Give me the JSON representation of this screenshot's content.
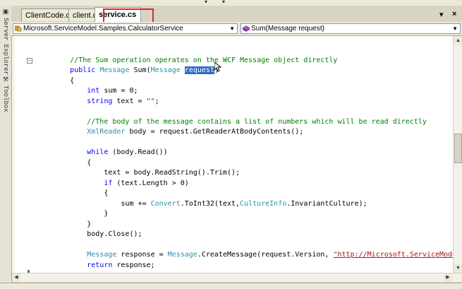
{
  "left_panels": [
    {
      "label": "Server Explorer",
      "icon": "server-explorer-icon"
    },
    {
      "label": "Toolbox",
      "icon": "toolbox-icon"
    }
  ],
  "tabs": [
    {
      "label": "ClientCode.cs",
      "active": false
    },
    {
      "label": "client.cs",
      "active": false
    },
    {
      "label": "service.cs",
      "active": true
    }
  ],
  "tab_controls": {
    "dropdown": "▾",
    "close": "×"
  },
  "navbar": {
    "type_combo": "Microsoft.ServiceModel.Samples.CalculatorService",
    "member_combo": "Sum(Message request)"
  },
  "code_lines": [
    "",
    "        //The Sum operation operates on the WCF Message object directly",
    "        public Message Sum(Message request)",
    "        {",
    "            int sum = 0;",
    "            string text = \"\";",
    "",
    "            //The body of the message contains a list of numbers which will be read directly",
    "            XmlReader body = request.GetReaderAtBodyContents();",
    "",
    "            while (body.Read())",
    "            {",
    "                text = body.ReadString().Trim();",
    "                if (text.Length > 0)",
    "                {",
    "                    sum += Convert.ToInt32(text,CultureInfo.InvariantCulture);",
    "                }",
    "            }",
    "            body.Close();",
    "",
    "            Message response = Message.CreateMessage(request.Version, \"http://Microsoft.ServiceModel.Samples",
    "            return response;",
    "",
    "        }"
  ],
  "selected_text": "request",
  "colors": {
    "keyword": "#0000ff",
    "type": "#2b91af",
    "comment": "#008000",
    "string": "#a31515",
    "selection": "#316ac5",
    "highlight_box": "#e0262e"
  }
}
